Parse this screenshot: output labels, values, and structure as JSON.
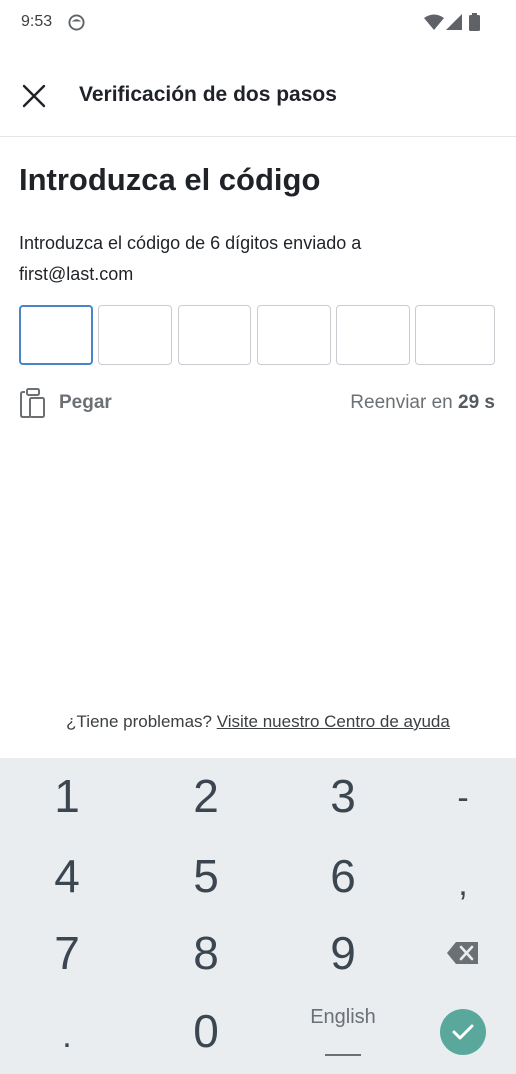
{
  "status_bar": {
    "time": "9:53",
    "icons": [
      "notification-face-icon",
      "wifi-icon",
      "signal-icon",
      "battery-icon"
    ]
  },
  "app_bar": {
    "title": "Verificación de dos pasos",
    "close_icon": "close-icon"
  },
  "content": {
    "heading": "Introduzca el código",
    "description": "Introduzca el código de 6 dígitos enviado a",
    "email": "first@last.com",
    "code_digits": [
      "",
      "",
      "",
      "",
      "",
      ""
    ],
    "paste_label": "Pegar",
    "paste_icon": "clipboard-icon",
    "resend_text": "Reenviar en",
    "resend_countdown": "29 s",
    "help_text": "¿Tiene problemas?",
    "help_link": "Visite nuestro Centro de ayuda"
  },
  "keyboard": {
    "keys": [
      "1",
      "2",
      "3",
      "-",
      "4",
      "5",
      "6",
      ",",
      "7",
      "8",
      "9",
      ".",
      "0"
    ],
    "language": "English",
    "backspace_icon": "backspace-icon",
    "enter_icon": "check-icon",
    "colors": {
      "background": "#e9edf0",
      "enter": "#5aa89c"
    }
  },
  "colors": {
    "active_border": "#4a86c7",
    "text": "#1f2328",
    "muted": "#6b7075"
  }
}
